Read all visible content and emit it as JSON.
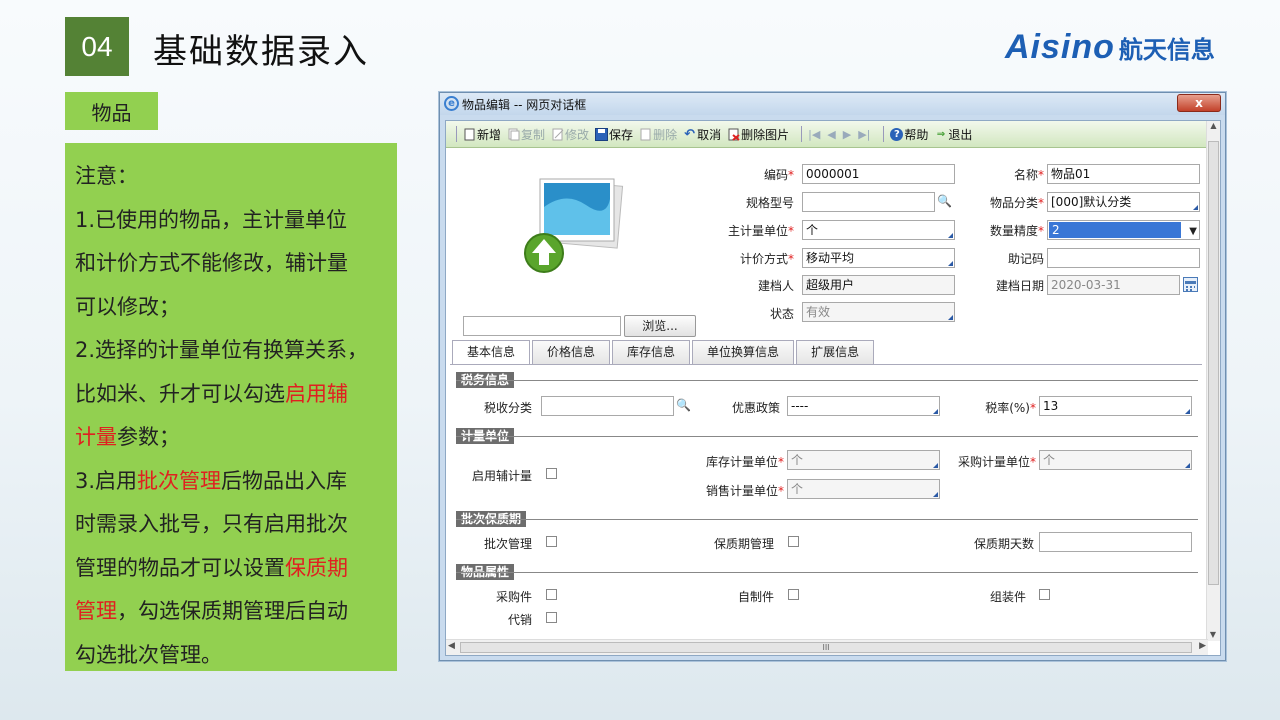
{
  "slide": {
    "number": "04",
    "title": "基础数据录入",
    "logo_en": "Aisino",
    "logo_cn": "航天信息",
    "tag": "物品",
    "note_lines": [
      [
        {
          "t": "注意："
        }
      ],
      [
        {
          "t": "1.已使用的物品，主计量单位"
        }
      ],
      [
        {
          "t": "和计价方式不能修改，辅计量"
        }
      ],
      [
        {
          "t": "可以修改；"
        }
      ],
      [
        {
          "t": "2.选择的计量单位有换算关系，"
        }
      ],
      [
        {
          "t": "比如米、升才可以勾选"
        },
        {
          "t": "启用辅",
          "red": true
        }
      ],
      [
        {
          "t": "计量",
          "red": true
        },
        {
          "t": "参数；"
        }
      ],
      [
        {
          "t": "3.启用"
        },
        {
          "t": "批次管理",
          "red": true
        },
        {
          "t": "后物品出入库"
        }
      ],
      [
        {
          "t": "时需录入批号，只有启用批次"
        }
      ],
      [
        {
          "t": "管理的物品才可以设置"
        },
        {
          "t": "保质期",
          "red": true
        }
      ],
      [
        {
          "t": "管理",
          "red": true
        },
        {
          "t": "，勾选保质期管理后自动"
        }
      ],
      [
        {
          "t": "勾选批次管理。"
        }
      ]
    ]
  },
  "dialog": {
    "title": "物品编辑 -- 网页对话框",
    "close": "x",
    "toolbar": {
      "new": "新增",
      "copy": "复制",
      "edit": "修改",
      "save": "保存",
      "delete": "删除",
      "cancel": "取消",
      "del_pic": "删除图片",
      "help": "帮助",
      "exit": "退出"
    },
    "browse": "浏览...",
    "form": {
      "code_label": "编码",
      "code": "0000001",
      "name_label": "名称",
      "name": "物品01",
      "spec_label": "规格型号",
      "spec": "",
      "category_label": "物品分类",
      "category": "[000]默认分类",
      "unit_label": "主计量单位",
      "unit": "个",
      "precision_label": "数量精度",
      "precision": "2",
      "pricing_label": "计价方式",
      "pricing": "移动平均",
      "mnemonic_label": "助记码",
      "mnemonic": "",
      "creator_label": "建档人",
      "creator": "超级用户",
      "date_label": "建档日期",
      "date": "2020-03-31",
      "status_label": "状态",
      "status": "有效"
    },
    "tabs": [
      "基本信息",
      "价格信息",
      "库存信息",
      "单位换算信息",
      "扩展信息"
    ],
    "sections": {
      "tax": "税务信息",
      "unit": "计量单位",
      "batch": "批次保质期",
      "attr": "物品属性"
    },
    "basic": {
      "tax_class_label": "税收分类",
      "tax_class": "",
      "policy_label": "优惠政策",
      "policy": "----",
      "rate_label": "税率(%)",
      "rate": "13",
      "aux_unit_label": "启用辅计量",
      "stock_unit_label": "库存计量单位",
      "stock_unit": "个",
      "purchase_unit_label": "采购计量单位",
      "purchase_unit": "个",
      "sales_unit_label": "销售计量单位",
      "sales_unit": "个",
      "batch_label": "批次管理",
      "shelf_label": "保质期管理",
      "shelf_days_label": "保质期天数",
      "shelf_days": "",
      "purchased_label": "采购件",
      "selfmade_label": "自制件",
      "assembly_label": "组装件",
      "consign_label": "代销"
    },
    "hscroll_text": "III"
  }
}
